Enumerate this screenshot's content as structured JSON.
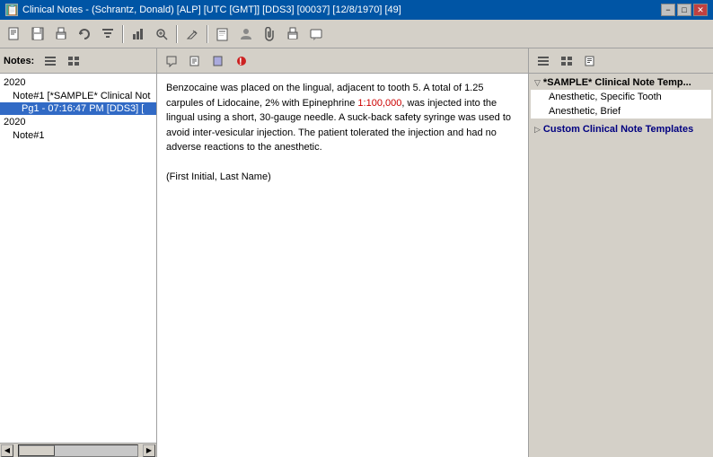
{
  "titlebar": {
    "icon": "📋",
    "title": "Clinical Notes - (Schrantz, Donald) [ALP] [UTC [GMT]] [DDS3] [00037] [12/8/1970] [49]",
    "minimize": "−",
    "maximize": "□",
    "close": "✕"
  },
  "toolbar": {
    "buttons": [
      {
        "name": "new-note",
        "icon": "📄"
      },
      {
        "name": "save",
        "icon": "💾"
      },
      {
        "name": "print",
        "icon": "🖨"
      },
      {
        "name": "refresh",
        "icon": "🔄"
      },
      {
        "name": "search",
        "icon": "🔍"
      },
      {
        "name": "zoom-in",
        "icon": "🔎"
      },
      {
        "name": "edit",
        "icon": "✏"
      },
      {
        "name": "note-template",
        "icon": "📋"
      },
      {
        "name": "user",
        "icon": "👤"
      },
      {
        "name": "attachment",
        "icon": "📎"
      },
      {
        "name": "print2",
        "icon": "🖨"
      },
      {
        "name": "message",
        "icon": "💬"
      }
    ]
  },
  "left_panel": {
    "notes_label": "Notes:",
    "tree_items": [
      {
        "type": "year",
        "label": "2020",
        "indent": 0
      },
      {
        "type": "note",
        "label": "Note#1 [*SAMPLE* Clinical Not",
        "indent": 1
      },
      {
        "type": "page",
        "label": "Pg1 - 07:16:47 PM [DDS3] [",
        "indent": 2,
        "selected": true
      },
      {
        "type": "year",
        "label": "2020",
        "indent": 0
      },
      {
        "type": "note",
        "label": "Note#1",
        "indent": 1
      }
    ]
  },
  "middle_panel": {
    "content_paragraphs": [
      {
        "parts": [
          {
            "text": "Benzocaine was placed on the lingual, adjacent to tooth 5. A total of 1.25 carpules of Lidocaine, 2% with Epinephrine ",
            "color": "black"
          },
          {
            "text": "1:100,000",
            "color": "red"
          },
          {
            "text": ", was injected into the lingual using a short, 30-gauge needle. A suck-back safety syringe was used to avoid inter-vesicular injection. The patient tolerated the injection and had no adverse reactions to the anesthetic.",
            "color": "black"
          }
        ]
      },
      {
        "parts": [
          {
            "text": "(First Initial, Last Name)",
            "color": "black"
          }
        ]
      }
    ]
  },
  "right_panel": {
    "groups": [
      {
        "label": "*SAMPLE* Clinical Note Temp...",
        "expanded": true,
        "children": [
          {
            "label": "Anesthetic, Specific Tooth"
          },
          {
            "label": "Anesthetic, Brief"
          }
        ]
      },
      {
        "label": "Custom Clinical Note Templates",
        "expanded": false,
        "children": []
      }
    ]
  }
}
